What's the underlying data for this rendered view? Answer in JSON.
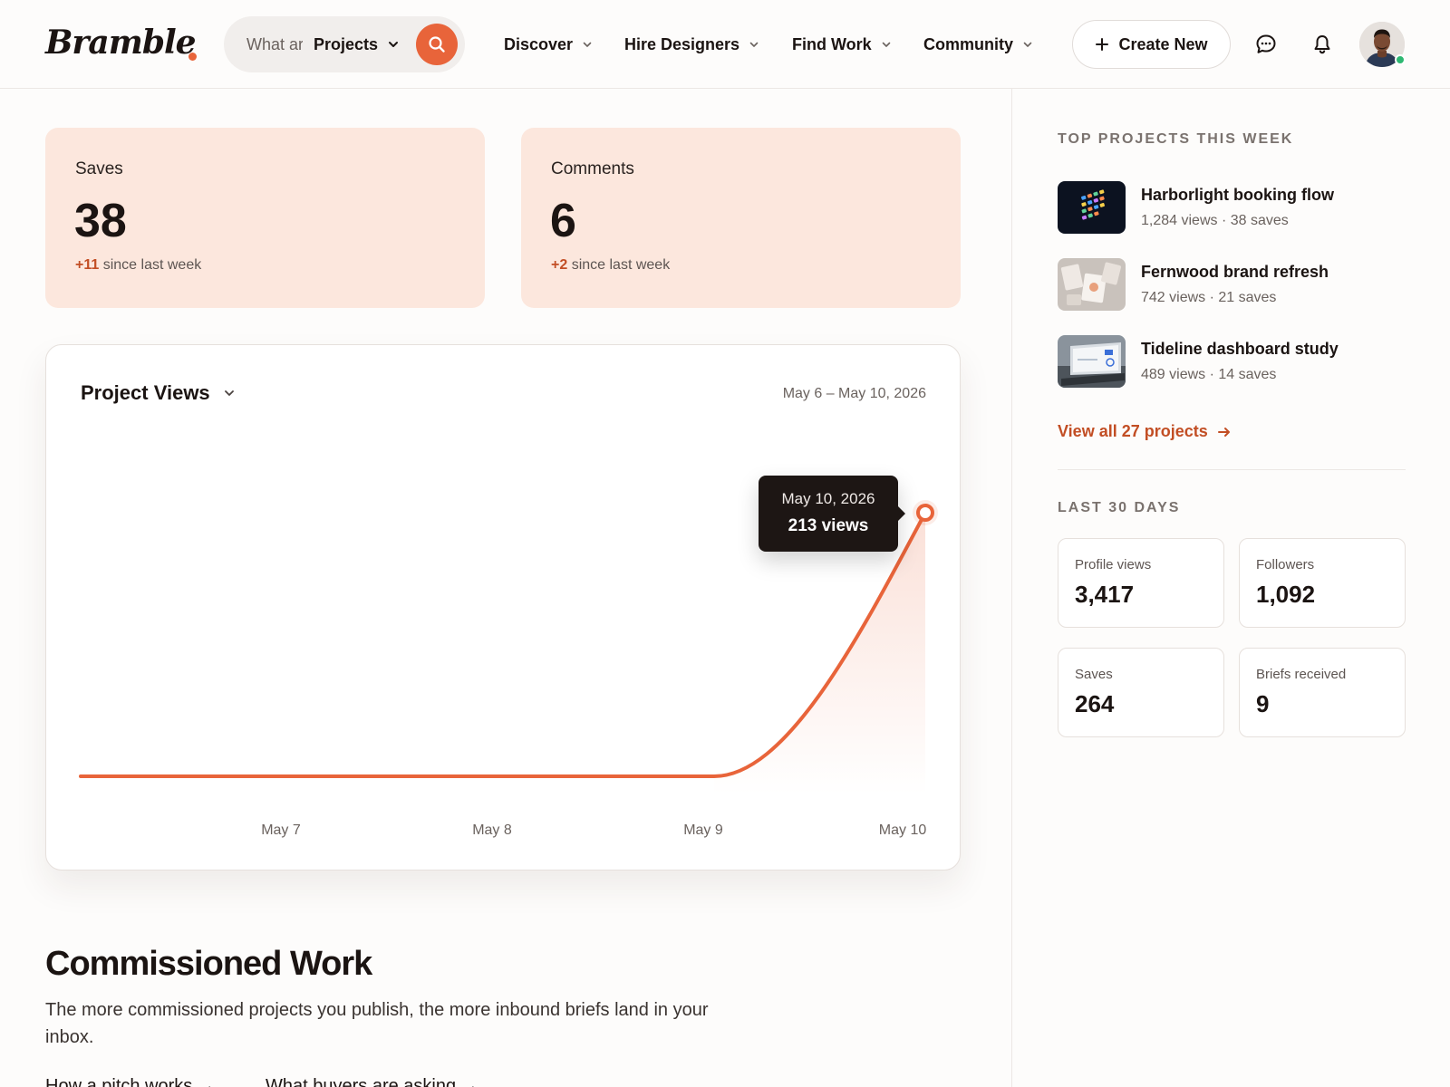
{
  "header": {
    "logo": "Bramble",
    "search": {
      "placeholder": "What are you looking for?",
      "scope": "Projects"
    },
    "nav": [
      "Discover",
      "Hire Designers",
      "Find Work",
      "Community"
    ],
    "create_label": "Create New",
    "icons": {
      "search": "search-icon",
      "messages": "chat-bubble-icon",
      "notifications": "bell-icon",
      "create": "plus-icon"
    },
    "user_status": "online"
  },
  "stats": [
    {
      "label": "Saves",
      "value": "38",
      "delta": "+11",
      "delta_text": "since last week"
    },
    {
      "label": "Comments",
      "value": "6",
      "delta": "+2",
      "delta_text": "since last week"
    }
  ],
  "chart": {
    "title": "Project Views",
    "range": "May 6 – May 10, 2026",
    "tooltip": {
      "date": "May 10, 2026",
      "value": "213 views"
    }
  },
  "chart_data": {
    "type": "area",
    "x": [
      "May 6",
      "May 7",
      "May 8",
      "May 9",
      "May 10"
    ],
    "series": [
      {
        "values": [
          0,
          0,
          0,
          0,
          213
        ]
      }
    ],
    "xtick_labels": [
      "May 7",
      "May 8",
      "May 9",
      "May 10"
    ],
    "ylim": [
      0,
      213
    ],
    "grid": false,
    "color": "#e8643a"
  },
  "commissioned": {
    "title": "Commissioned Work",
    "description": "The more commissioned projects you publish, the more inbound briefs land in your inbox.",
    "links": [
      "How a pitch works",
      "What buyers are asking"
    ]
  },
  "sidebar": {
    "top_heading": "TOP PROJECTS THIS WEEK",
    "projects": [
      {
        "name": "Harborlight booking flow",
        "meta": "1,284 views · 38 saves"
      },
      {
        "name": "Fernwood brand refresh",
        "meta": "742 views · 21 saves"
      },
      {
        "name": "Tideline dashboard study",
        "meta": "489 views · 14 saves"
      }
    ],
    "view_all": "View all 27 projects",
    "last30_heading": "LAST 30 DAYS",
    "metrics": [
      {
        "label": "Profile views",
        "value": "3,417"
      },
      {
        "label": "Followers",
        "value": "1,092"
      },
      {
        "label": "Saves",
        "value": "264"
      },
      {
        "label": "Briefs received",
        "value": "9"
      }
    ]
  },
  "colors": {
    "accent": "#e8643a",
    "accent_text": "#c24e24",
    "card_tint": "#fce7dd",
    "ink": "#1b1412"
  }
}
